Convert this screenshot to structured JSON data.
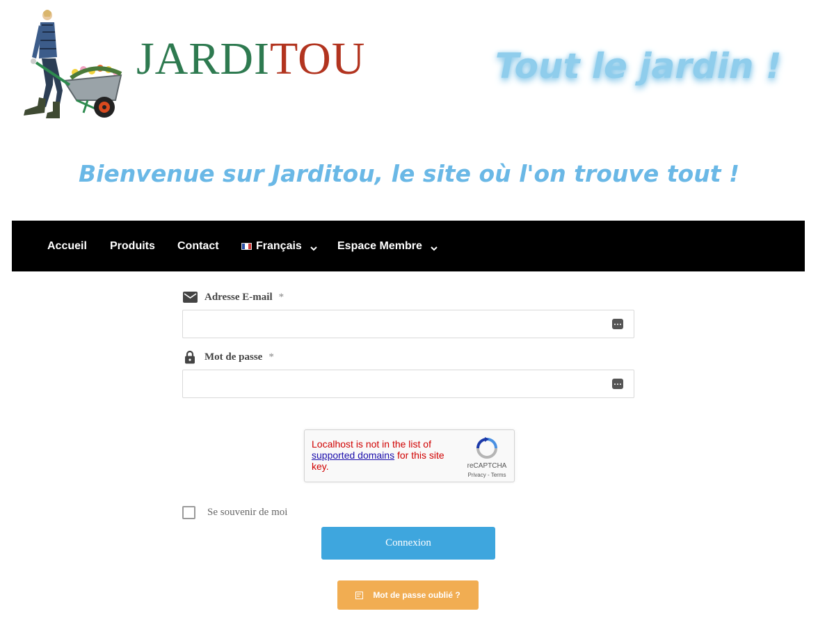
{
  "header": {
    "brand_part1": "JARDI",
    "brand_part2": "TOU",
    "slogan": "Tout le jardin !",
    "welcome": "Bienvenue sur Jarditou, le site où l'on trouve tout !"
  },
  "nav": {
    "items": [
      {
        "label": "Accueil"
      },
      {
        "label": "Produits"
      },
      {
        "label": "Contact"
      },
      {
        "label": "Français",
        "icon": "france-flag-icon",
        "dropdown": true
      },
      {
        "label": "Espace Membre",
        "dropdown": true
      }
    ]
  },
  "form": {
    "email": {
      "label": "Adresse E-mail",
      "required_mark": "*",
      "icon": "envelope-icon",
      "value": ""
    },
    "password": {
      "label": "Mot de passe",
      "required_mark": "*",
      "icon": "lock-icon",
      "value": ""
    }
  },
  "captcha": {
    "error_prefix": "Localhost is not in the list of ",
    "error_link": "supported domains",
    "error_suffix": " for this site key.",
    "brand": "reCAPTCHA",
    "links": "Privacy - Terms"
  },
  "remember": {
    "label": "Se souvenir de moi",
    "checked": false
  },
  "buttons": {
    "login": "Connexion",
    "forgot": "Mot de passe oublié ?"
  },
  "colors": {
    "brand_green": "#2e7a50",
    "brand_red": "#b2341f",
    "slogan_blue": "#8fcdec",
    "login_blue": "#3ea6de",
    "forgot_orange": "#f1ad52",
    "nav_bg": "#000000"
  }
}
